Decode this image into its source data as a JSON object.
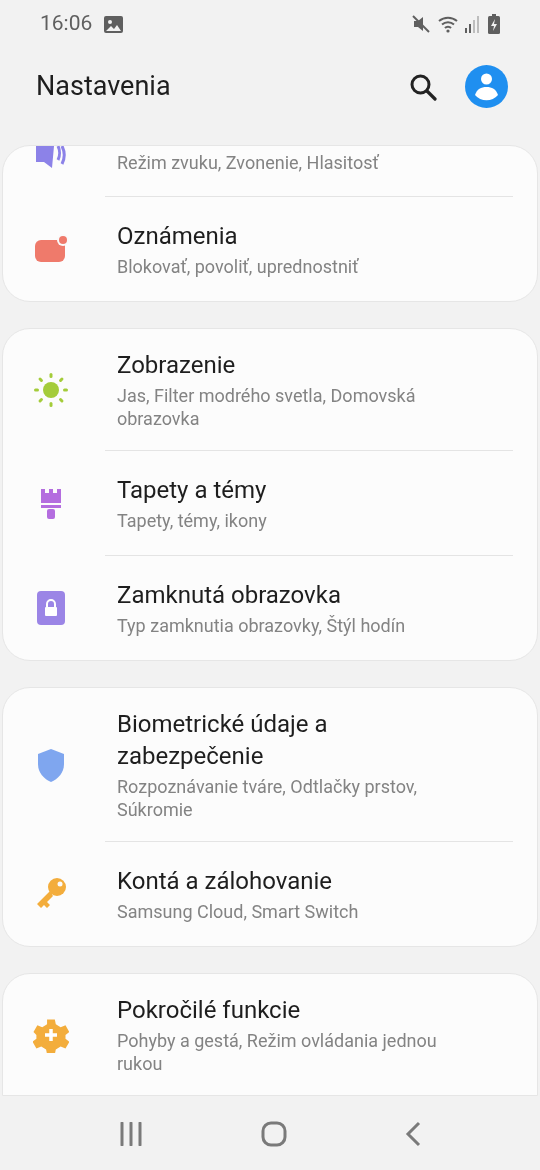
{
  "status_bar": {
    "time": "16:06"
  },
  "header": {
    "title": "Nastavenia"
  },
  "groups": [
    {
      "items": [
        {
          "kind": "sound",
          "subtitle": "Režim zvuku, Zvonenie, Hlasitosť"
        },
        {
          "kind": "notifications",
          "title": "Oznámenia",
          "subtitle": "Blokovať, povoliť, uprednostniť"
        }
      ]
    },
    {
      "items": [
        {
          "kind": "display",
          "title": "Zobrazenie",
          "subtitle": "Jas, Filter modrého svetla, Domovská obrazovka"
        },
        {
          "kind": "wallpaper",
          "title": "Tapety a témy",
          "subtitle": "Tapety, témy, ikony"
        },
        {
          "kind": "lock",
          "title": "Zamknutá obrazovka",
          "subtitle": "Typ zamknutia obrazovky, Štýl hodín"
        }
      ]
    },
    {
      "items": [
        {
          "kind": "security",
          "title": "Biometrické údaje a zabezpečenie",
          "subtitle": "Rozpoznávanie tváre, Odtlačky prstov, Súkromie"
        },
        {
          "kind": "accounts",
          "title": "Kontá a zálohovanie",
          "subtitle": "Samsung Cloud, Smart Switch"
        }
      ]
    },
    {
      "items": [
        {
          "kind": "advanced",
          "title": "Pokročilé funkcie",
          "subtitle": "Pohyby a gestá, Režim ovládania jednou rukou"
        }
      ]
    }
  ]
}
